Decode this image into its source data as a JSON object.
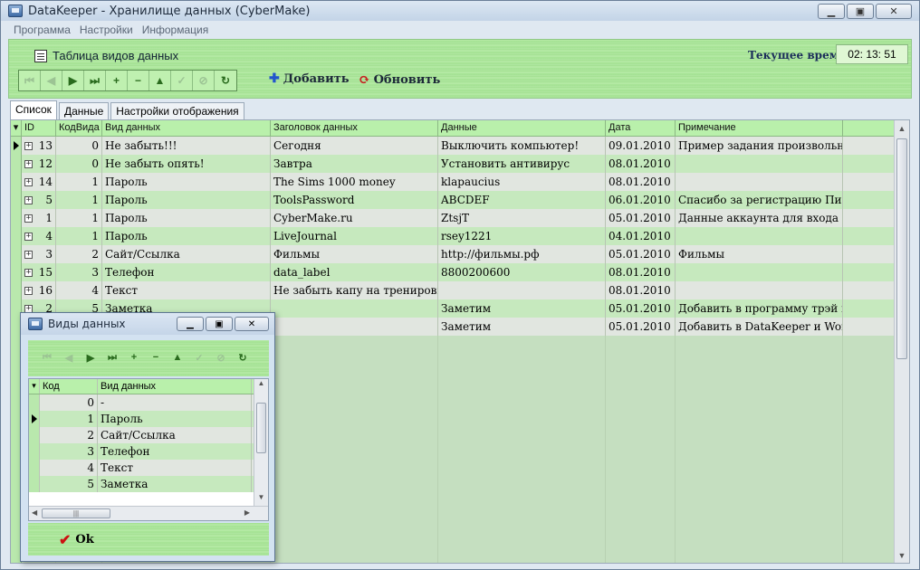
{
  "window": {
    "title": "DataKeeper - Хранилище данных (CyberMake)",
    "minimize": "▁",
    "maximize": "▣",
    "close": "✕"
  },
  "menu": [
    "Программа",
    "Настройки",
    "Информация"
  ],
  "panel": {
    "title": "Таблица видов данных",
    "add_label": "Добавить",
    "refresh_label": "Обновить",
    "clock_label": "Текущее время:",
    "clock_value": "02: 13: 51"
  },
  "nav_buttons": [
    {
      "name": "first-record-icon",
      "glyph": "⏮",
      "disabled": true
    },
    {
      "name": "prev-record-icon",
      "glyph": "◀",
      "disabled": true
    },
    {
      "name": "next-record-icon",
      "glyph": "▶",
      "disabled": false
    },
    {
      "name": "last-record-icon",
      "glyph": "⏭",
      "disabled": false
    },
    {
      "name": "insert-record-icon",
      "glyph": "+",
      "disabled": false
    },
    {
      "name": "delete-record-icon",
      "glyph": "−",
      "disabled": false
    },
    {
      "name": "edit-record-icon",
      "glyph": "▲",
      "disabled": false
    },
    {
      "name": "post-edit-icon",
      "glyph": "✓",
      "disabled": true
    },
    {
      "name": "cancel-edit-icon",
      "glyph": "⊘",
      "disabled": true
    },
    {
      "name": "refresh-data-icon",
      "glyph": "↻",
      "disabled": false
    }
  ],
  "tabs": [
    "Список",
    "Данные",
    "Настройки отображения"
  ],
  "grid": {
    "columns": [
      "ID",
      "КодВида",
      "Вид данных",
      "Заголовок данных",
      "Данные",
      "Дата",
      "Примечание"
    ],
    "rows": [
      {
        "id": "13",
        "kod": "0",
        "vid": "Не забыть!!!",
        "title": "Сегодня",
        "data": "Выключить компьютер!",
        "date": "09.01.2010",
        "note": "Пример задания произвольной д"
      },
      {
        "id": "12",
        "kod": "0",
        "vid": "Не забыть опять!",
        "title": "Завтра",
        "data": "Установить антивирус",
        "date": "08.01.2010",
        "note": ""
      },
      {
        "id": "14",
        "kod": "1",
        "vid": "Пароль",
        "title": "The Sims 1000 money",
        "data": "klapaucius",
        "date": "08.01.2010",
        "note": ""
      },
      {
        "id": "5",
        "kod": "1",
        "vid": "Пароль",
        "title": "ToolsPassword",
        "data": "ABCDEF",
        "date": "06.01.2010",
        "note": "Спасибо за регистрацию Письмо"
      },
      {
        "id": "1",
        "kod": "1",
        "vid": "Пароль",
        "title": "CyberMake.ru",
        "data": "ZtsjT",
        "date": "05.01.2010",
        "note": "Данные аккаунта для входа в Пан"
      },
      {
        "id": "4",
        "kod": "1",
        "vid": "Пароль",
        "title": "LiveJournal",
        "data": "rsey1221",
        "date": "04.01.2010",
        "note": ""
      },
      {
        "id": "3",
        "kod": "2",
        "vid": "Сайт/Ссылка",
        "title": "Фильмы",
        "data": "http://фильмы.рф",
        "date": "05.01.2010",
        "note": "Фильмы"
      },
      {
        "id": "15",
        "kod": "3",
        "vid": "Телефон",
        "title": "data_label",
        "data": "8800200600",
        "date": "08.01.2010",
        "note": ""
      },
      {
        "id": "16",
        "kod": "4",
        "vid": "Текст",
        "title": "Не забыть капу на тренировку",
        "data": "",
        "date": "08.01.2010",
        "note": ""
      },
      {
        "id": "2",
        "kod": "5",
        "vid": "Заметка",
        "title": "",
        "data": "Заметим",
        "date": "05.01.2010",
        "note": "Добавить в программу трэй икон"
      },
      {
        "id": "",
        "kod": "",
        "vid": "",
        "title": "",
        "data": "Заметим",
        "date": "05.01.2010",
        "note": "Добавить в DataKeeper и WorkT"
      }
    ]
  },
  "popup": {
    "title": "Виды данных",
    "columns": [
      "Код",
      "Вид данных"
    ],
    "rows": [
      {
        "kod": "0",
        "vid": "-"
      },
      {
        "kod": "1",
        "vid": "Пароль"
      },
      {
        "kod": "2",
        "vid": "Сайт/Ссылка"
      },
      {
        "kod": "3",
        "vid": "Телефон"
      },
      {
        "kod": "4",
        "vid": "Текст"
      },
      {
        "kod": "5",
        "vid": "Заметка"
      }
    ],
    "ok_label": "Ok"
  }
}
